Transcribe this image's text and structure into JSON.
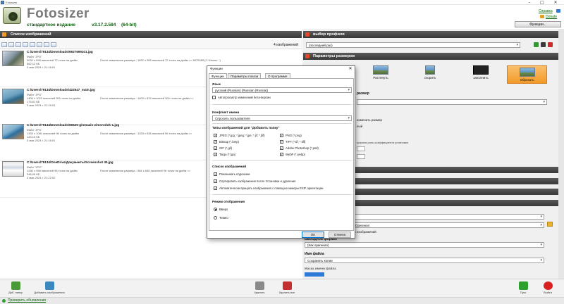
{
  "window": {
    "title": "Fotosizer",
    "controls": [
      "–",
      "□",
      "✕"
    ]
  },
  "header": {
    "brand": "Fotosizer",
    "edition": "стандартное издание",
    "version": "v3.17.2.584",
    "arch": "(64-bit)",
    "links": [
      "Справка",
      "Donate"
    ],
    "functions_button": "Функции..."
  },
  "left_panel": {
    "title": "Список изображений",
    "count_label": "4 изображений",
    "items": [
      {
        "path": "C:\\Users\\79134\\Downloads\\6927699101.jpg",
        "type": "Файл \"JPG\"",
        "size": "3032 х 595 пикселей 72 точек на дюйм",
        "filesize": "562,12 КБ",
        "date": "3 мая 2024 г. 21:16:01",
        "extra": "После изменения размера : 1632 х 595 пикселей 72 точек на дюйм >> 8075389 (C:\\Users\\...)"
      },
      {
        "path": "C:\\Users\\79134\\Downloads\\422547_main.jpg",
        "type": "Файл \"JPG\"",
        "size": "1400 х 1022 пикселей 300 точек на дюйм",
        "filesize": "175,61 КБ",
        "date": "3 мая 2024 г. 21:16:01",
        "extra": "После изменения размера : 1400 х 876 пикселей 300 точек на дюйм >>"
      },
      {
        "path": "C:\\Users\\79134\\Downloads\\66625-gimnazio-zimorodok-1.jpg",
        "type": "Файл \"JPG\"",
        "size": "1333 х 1081 пикселей 96 точек на дюйм",
        "filesize": "143,13 КБ",
        "date": "3 мая 2024 г. 21:16:01",
        "extra": "После изменения размера : 1333 х 636 пикселей 96 точек на дюйм >>"
      },
      {
        "path": "C:\\Users\\79134\\OneDrive\\Документы\\Screenshot 40.jpg",
        "type": "Файл \"JPG\"",
        "size": "1280 х 956 пикселей 96 точек на дюйм",
        "filesize": "346,05 КБ",
        "date": "3 мая 2024 г. 21:22:02",
        "extra": "После изменения размера : 984 х 645 пикселей 96 точек на дюйм >>"
      }
    ]
  },
  "right_panel": {
    "profile_title": "выбор профиля",
    "profile_value": "(последний раз)",
    "size_title": "Параметры размеров",
    "resize_modes": [
      "Растянуть",
      "спорить",
      "заполнить",
      "Обрезать"
    ],
    "labels_right": [
      "размер",
      "изменить размер",
      "ный",
      "ширина роль коэффициента установки"
    ],
    "folder_value": "Оригинал",
    "folder_note": "ах изображений",
    "output_format_label": "Выходной формат",
    "output_format_value": "(Как оригинал)",
    "filename_label": "Имя файла",
    "filename_value": "Сохранить копии",
    "mask_label": "Маска имени файла"
  },
  "dialog": {
    "title": "Функции",
    "tabs": [
      "Функции",
      "Параметры показа",
      "О программе"
    ],
    "lang_label": "Язык",
    "lang_value": "русский (Russian) (Russian (Russia))",
    "auto_translate": "Автопросмотр изменений бета-версии",
    "conflict_label": "Конфликт имени",
    "conflict_value": "Спросить пользователя",
    "types_label": "Типы изображений для \"Добавить папку\"",
    "types": [
      {
        "label": "JPEG (*.jpg; *.jpeg; *.jpe; *.jif; *.jfif)",
        "on": true
      },
      {
        "label": "PNG (*.png)",
        "on": true
      },
      {
        "label": "Bitmap (*.bmp)",
        "on": true
      },
      {
        "label": "TIFF (*.tif; *.tiff)",
        "on": true
      },
      {
        "label": "GIF (*.gif)",
        "on": true
      },
      {
        "label": "Adobe Photoshop (*.psd)",
        "on": true
      },
      {
        "label": "Targa (*.tga)",
        "on": true
      },
      {
        "label": "WebP (*.webp)",
        "on": true
      }
    ],
    "list_label": "Список изображений",
    "list_options": [
      {
        "label": "Показывать подсказки",
        "on": true
      },
      {
        "label": "Сортировать изображения после Установки и удаления",
        "on": true
      },
      {
        "label": "Автоматически вращать изображения с помощью камеры EXIF ориентации",
        "on": true
      }
    ],
    "mode_label": "Режим отображения",
    "modes": [
      {
        "label": "Вверх",
        "on": true
      },
      {
        "label": "Темно",
        "on": false
      }
    ],
    "ok": "OK",
    "cancel": "Отмена"
  },
  "bottom": {
    "buttons": [
      "Доб. папку",
      "Добавить изображения",
      "Удалить",
      "Удалить все",
      "Пуск",
      "Выйти"
    ],
    "status": "Проверить обновления"
  },
  "colors": {
    "accent_orange": "#f29a28",
    "header_dark": "#3a3a3a",
    "brand_green": "#0f5c0f"
  }
}
